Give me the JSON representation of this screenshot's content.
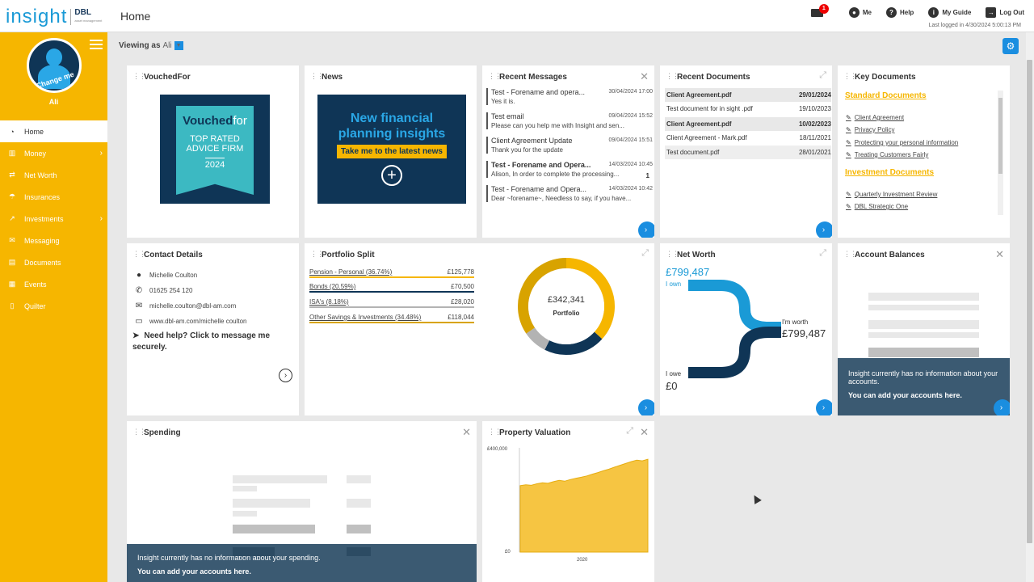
{
  "header": {
    "logo": "insight",
    "logo_partner": "DBL",
    "logo_partner_sub": "asset management",
    "title": "Home",
    "mail_badge": "1",
    "me": "Me",
    "help": "Help",
    "guide": "My Guide",
    "logout": "Log Out",
    "last_logged": "Last logged in 4/30/2024 5:00:13 PM"
  },
  "sidebar": {
    "avatar_text": "Change me",
    "user": "Ali",
    "items": [
      {
        "label": "Home",
        "icon": "dashboard-icon",
        "active": true
      },
      {
        "label": "Money",
        "icon": "bank-icon",
        "chevron": true
      },
      {
        "label": "Net Worth",
        "icon": "exchange-icon"
      },
      {
        "label": "Insurances",
        "icon": "umbrella-icon"
      },
      {
        "label": "Investments",
        "icon": "chart-icon",
        "chevron": true
      },
      {
        "label": "Messaging",
        "icon": "envelope-icon"
      },
      {
        "label": "Documents",
        "icon": "document-icon"
      },
      {
        "label": "Events",
        "icon": "calendar-icon"
      },
      {
        "label": "Quilter",
        "icon": "page-icon"
      }
    ]
  },
  "viewing": {
    "label": "Viewing as",
    "user": "Ali"
  },
  "vouched": {
    "title": "VouchedFor",
    "brand": "Vouched",
    "brand2": "for",
    "l1": "TOP RATED",
    "l2": "ADVICE FIRM",
    "year": "2024"
  },
  "news": {
    "title": "News",
    "headline1": "New financial",
    "headline2": "planning insights",
    "button": "Take me to the latest news"
  },
  "messages": {
    "title": "Recent Messages",
    "items": [
      {
        "title": "Test - Forename and opera...",
        "date": "30/04/2024 17:00",
        "body": "Yes it is.",
        "bold": false,
        "count": ""
      },
      {
        "title": "Test email",
        "date": "09/04/2024 15:52",
        "body": "Please can you help me with Insight and sen...",
        "bold": false,
        "count": ""
      },
      {
        "title": "Client Agreement Update",
        "date": "09/04/2024 15:51",
        "body": "Thank you for the update",
        "bold": false,
        "count": ""
      },
      {
        "title": "Test - Forename and Opera...",
        "date": "14/03/2024 10:45",
        "body": "Alison,    In order to complete the processing...",
        "bold": true,
        "count": "1"
      },
      {
        "title": "Test - Forename and Opera...",
        "date": "14/03/2024 10:42",
        "body": "Dear ~forename~, Needless to say, if you have...",
        "bold": false,
        "count": ""
      }
    ]
  },
  "documents": {
    "title": "Recent Documents",
    "items": [
      {
        "name": "Client Agreement.pdf",
        "date": "29/01/2024",
        "hl": true
      },
      {
        "name": "Test document for in sight .pdf",
        "date": "19/10/2023",
        "hl": false
      },
      {
        "name": "Client Agreement.pdf",
        "date": "10/02/2023",
        "hl": true
      },
      {
        "name": "Client Agreement - Mark.pdf",
        "date": "18/11/2021",
        "hl": false
      },
      {
        "name": "Test document.pdf",
        "date": "28/01/2021",
        "hl": false
      }
    ]
  },
  "keydocs": {
    "title": "Key Documents",
    "standard": "Standard Documents",
    "standard_links": [
      "Client Agreement",
      "Privacy Policy",
      "Protecting your personal information",
      "Treating Customers Fairly"
    ],
    "investment": "Investment Documents",
    "investment_links": [
      "Quarterly Investment Review",
      "DBL Strategic One"
    ]
  },
  "contact": {
    "title": "Contact Details",
    "name": "Michelle Coulton",
    "phone": "01625 254 120",
    "email": "michelle.coulton@dbl-am.com",
    "web": "www.dbl-am.com/michelle coulton",
    "help": "Need help? Click to message me securely."
  },
  "portfolio": {
    "title": "Portfolio Split",
    "total": "£342,341",
    "label": "Portfolio",
    "rows": [
      {
        "label": "Pension - Personal (36.74%)",
        "value": "£125,778",
        "color": "#f6b600"
      },
      {
        "label": "Bonds (20.59%)",
        "value": "£70,500",
        "color": "#0f3556"
      },
      {
        "label": "ISA's (8.18%)",
        "value": "£28,020",
        "color": "#b3b3b3"
      },
      {
        "label": "Other Savings & Investments (34.48%)",
        "value": "£118,044",
        "color": "#d8a300"
      }
    ]
  },
  "networth": {
    "title": "Net Worth",
    "own_value": "£799,487",
    "own_label": "I own",
    "worth_label": "I'm worth",
    "worth_value": "£799,487",
    "owe_label": "I owe",
    "owe_value": "£0"
  },
  "accounts": {
    "title": "Account Balances",
    "info": "Insight currently has no information about your accounts.",
    "cta": "You can add your accounts here."
  },
  "spending": {
    "title": "Spending",
    "info": "Insight currently has no information about your spending.",
    "cta": "You can add your accounts here."
  },
  "property": {
    "title": "Property Valuation",
    "y_top": "£400,000",
    "y_bottom": "£0",
    "x_label": "2020"
  },
  "chart_data": {
    "type": "area",
    "title": "Property Valuation",
    "xlabel": "",
    "ylabel": "",
    "ylim": [
      0,
      400000
    ],
    "x_ticks": [
      "2020"
    ],
    "color": "#f6c542",
    "values": [
      255000,
      258000,
      256000,
      262000,
      266000,
      264000,
      270000,
      275000,
      272000,
      278000,
      283000,
      287000,
      292000,
      299000,
      305000,
      312000,
      318000,
      326000,
      333000,
      340000,
      347000,
      353000,
      350000,
      356000
    ]
  }
}
